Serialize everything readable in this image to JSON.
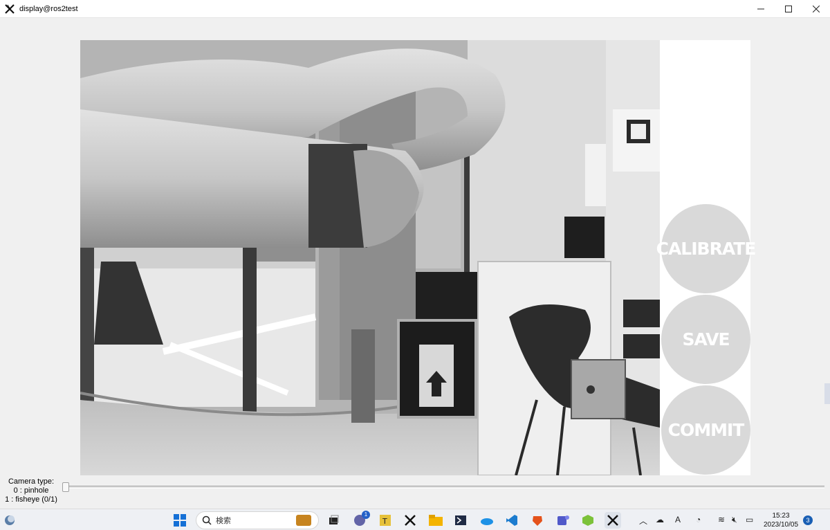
{
  "window": {
    "title": "display@ros2test"
  },
  "panel": {
    "calibrate_label": "CALIBRATE",
    "save_label": "SAVE",
    "commit_label": "COMMIT"
  },
  "camera_type": {
    "heading": "Camera type:",
    "option0": "0 : pinhole",
    "option1": "1 : fisheye (0/1)",
    "value": 0
  },
  "taskbar": {
    "search_label": "検索",
    "chat_badge": "1",
    "time": "15:23",
    "date": "2023/10/05",
    "notification_count": "3"
  },
  "icons": {
    "app": "x-logo-icon",
    "start": "windows-start-icon",
    "search": "search-icon"
  },
  "colors": {
    "button_fill": "#d9d9d9",
    "button_text": "#ffffff",
    "accent": "#1a5fb4"
  }
}
